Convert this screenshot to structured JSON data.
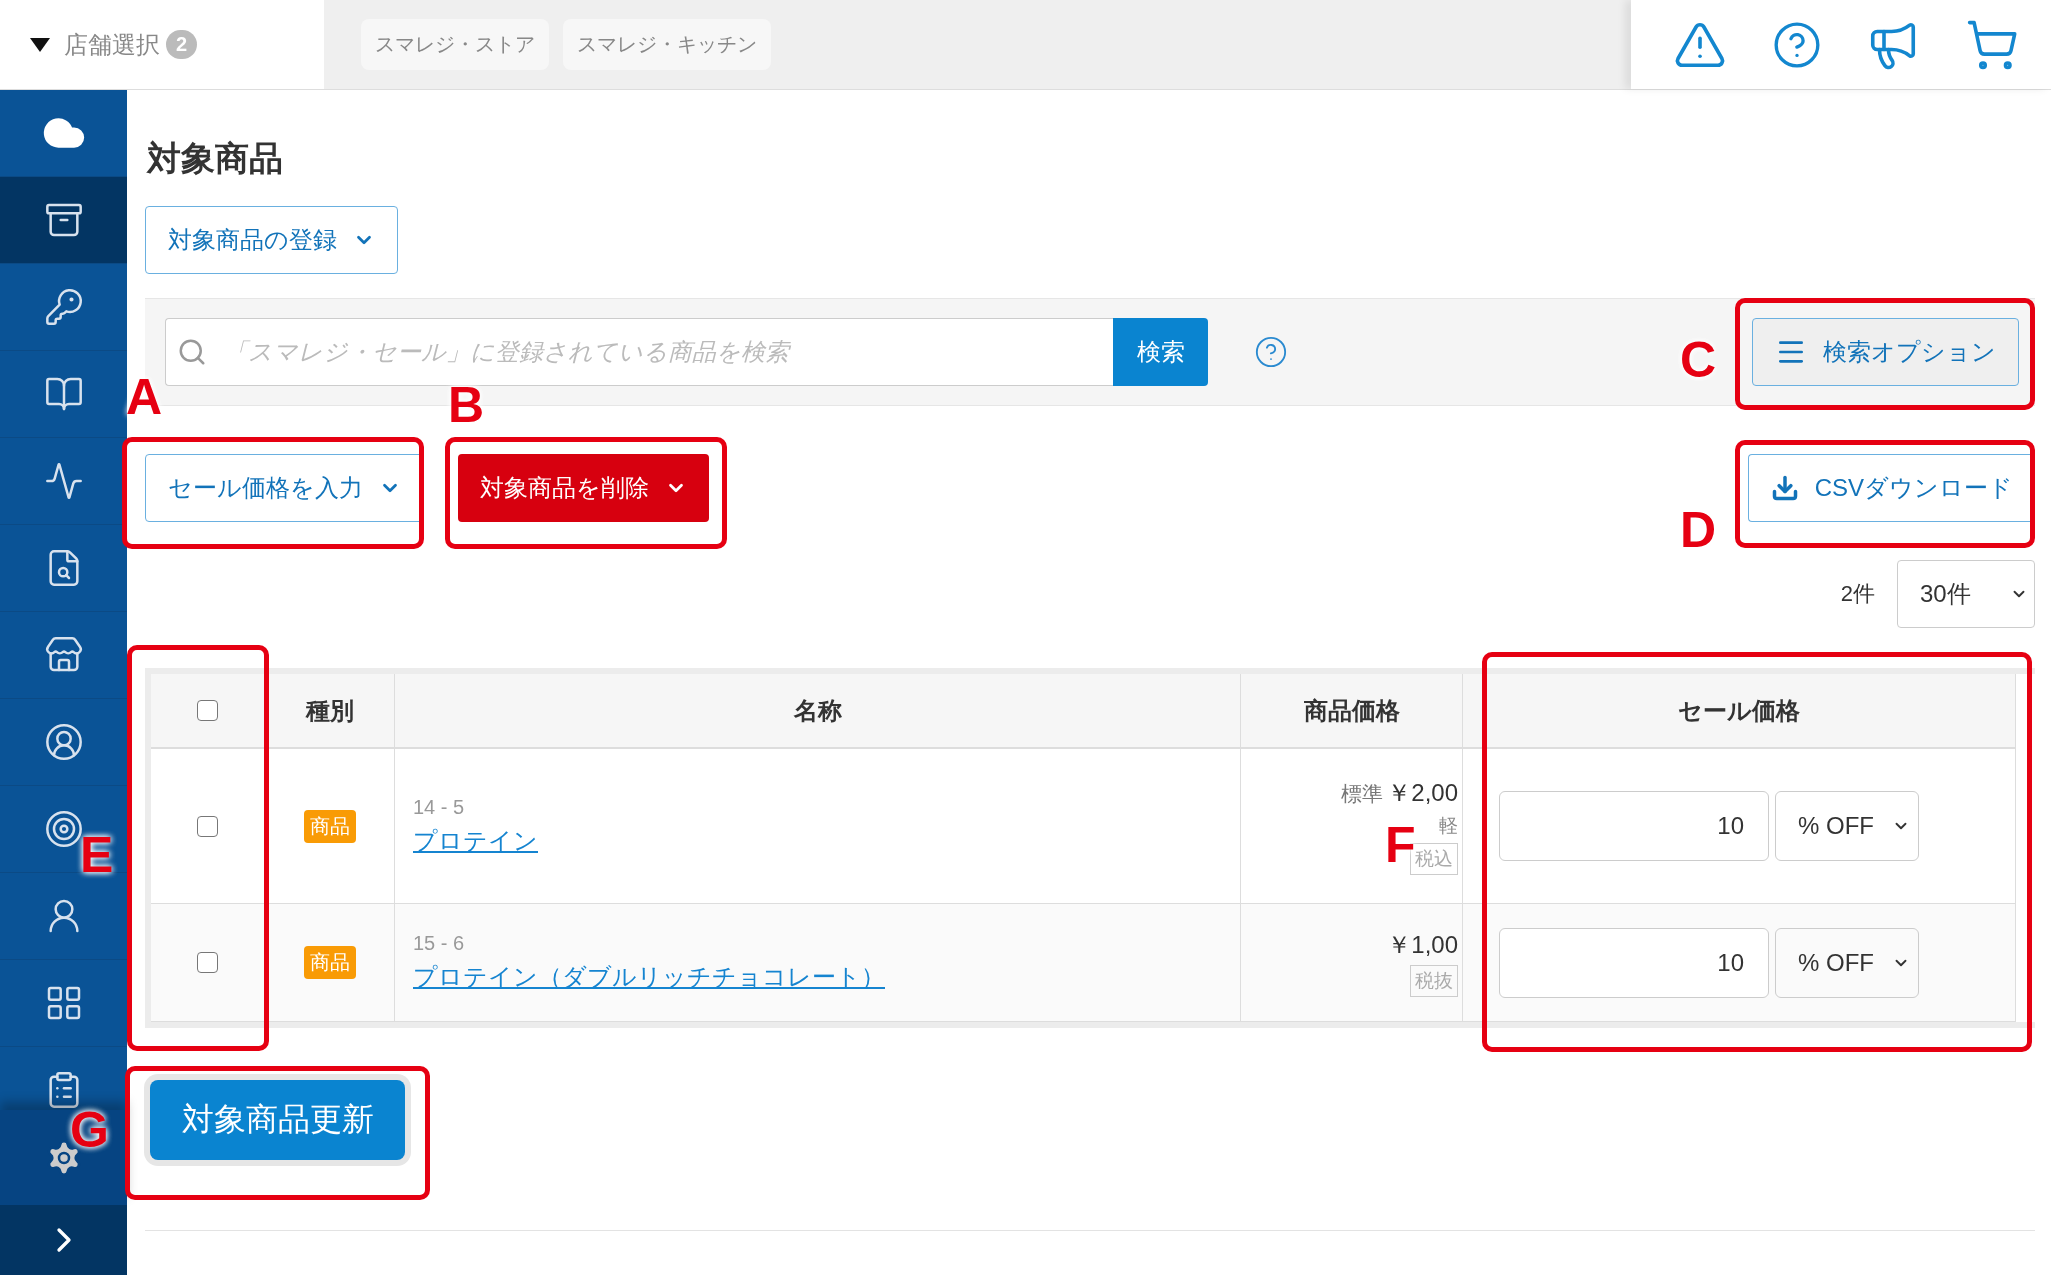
{
  "store_selector": {
    "label": "店舗選択",
    "count": "2"
  },
  "store_tabs": [
    "スマレジ・ストア",
    "スマレジ・キッチン"
  ],
  "sidebar": {
    "items": [
      {
        "kind": "cloud",
        "selected": false
      },
      {
        "kind": "box",
        "selected": true
      },
      {
        "kind": "key",
        "selected": false
      },
      {
        "kind": "book",
        "selected": false
      },
      {
        "kind": "chart",
        "selected": false
      },
      {
        "kind": "report",
        "selected": false
      },
      {
        "kind": "store",
        "selected": false
      },
      {
        "kind": "staff",
        "selected": false
      },
      {
        "kind": "target",
        "selected": false
      },
      {
        "kind": "user",
        "selected": false
      },
      {
        "kind": "grid",
        "selected": false
      },
      {
        "kind": "clipboard",
        "selected": false
      }
    ]
  },
  "page_title": "対象商品",
  "register_button": "対象商品の登録",
  "search": {
    "placeholder": "「スマレジ・セール」に登録されている商品を検索",
    "button": "検索",
    "options_button": "検索オプション"
  },
  "actions": {
    "sale_price_button": "セール価格を入力",
    "delete_button": "対象商品を削除",
    "csv_button": "CSVダウンロード"
  },
  "result_count": "2件",
  "per_page": "30件",
  "table": {
    "select_all_checked": false,
    "columns": [
      "種別",
      "名称",
      "商品価格",
      "セール価格"
    ],
    "rows": [
      {
        "checked": false,
        "type": "商品",
        "code": "14 - 5",
        "name": "プロテイン",
        "price_label": "標準",
        "price": "￥2,00",
        "price_note": "軽",
        "tax_tag": "税込",
        "sale_value": "10",
        "sale_unit": "% OFF"
      },
      {
        "checked": false,
        "type": "商品",
        "code": "15 - 6",
        "name": "プロテイン（ダブルリッチチョコレート）",
        "price": "￥1,00",
        "tax_tag": "税抜",
        "sale_value": "10",
        "sale_unit": "% OFF"
      }
    ]
  },
  "update_button": "対象商品更新",
  "annotations": [
    {
      "letter": "A"
    },
    {
      "letter": "B"
    },
    {
      "letter": "C"
    },
    {
      "letter": "D"
    },
    {
      "letter": "E"
    },
    {
      "letter": "F"
    },
    {
      "letter": "G"
    }
  ]
}
